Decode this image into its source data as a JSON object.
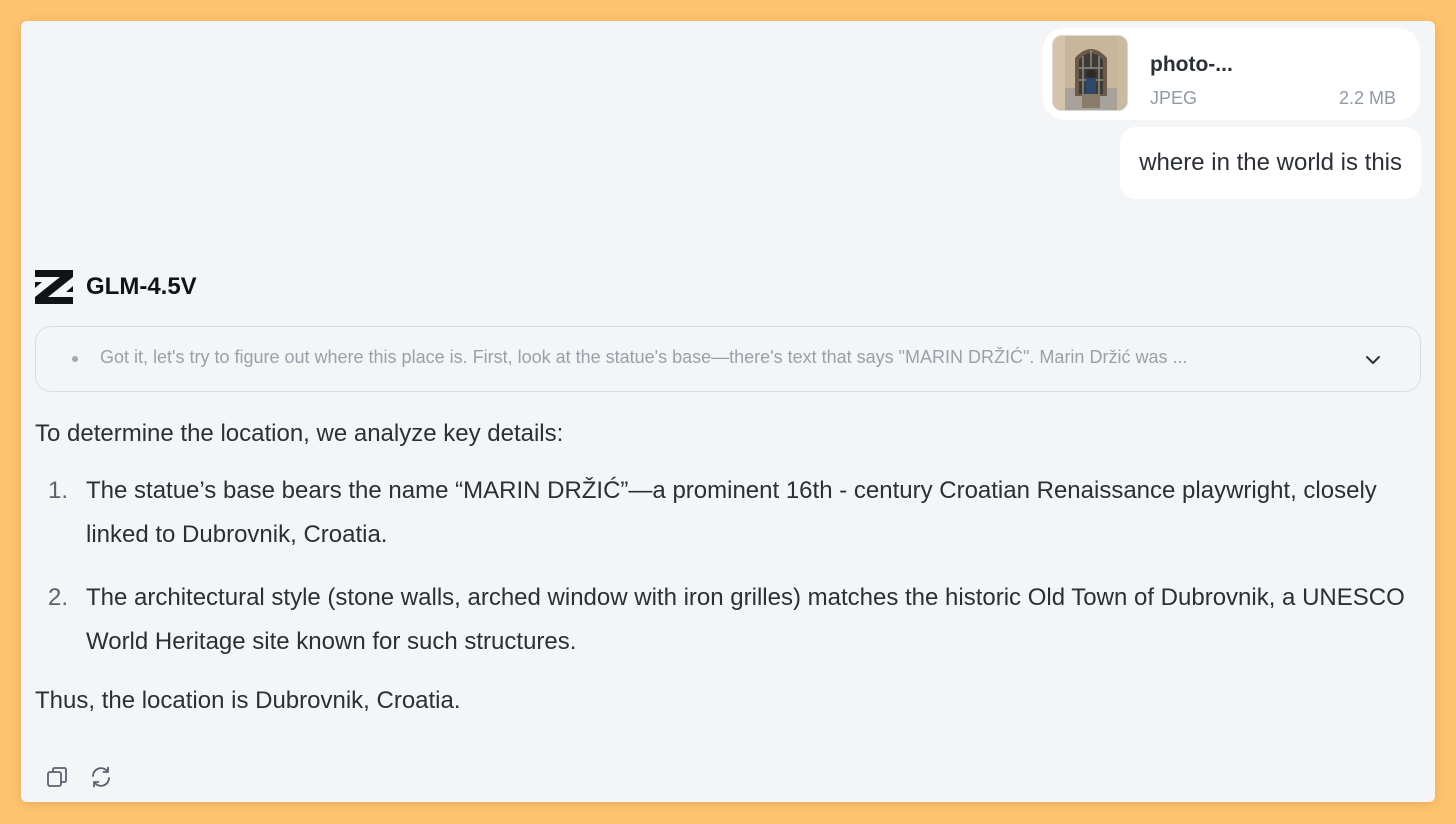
{
  "attachment": {
    "name": "photo-...",
    "type": "JPEG",
    "size": "2.2 MB",
    "thumbnail_icon": "photo-thumbnail"
  },
  "user_message": "where in the world is this",
  "model": {
    "name": "GLM-4.5V",
    "logo_icon": "z-logo-icon"
  },
  "thinking": {
    "preview": "Got it, let's try to figure out where this place is. First, look at the statue's base—there's text that says \"MARIN DRŽIĆ\". Marin Držić was ...",
    "expand_icon": "chevron-down-icon"
  },
  "answer": {
    "intro": "To determine the location, we analyze key details:",
    "items": [
      {
        "number": "1.",
        "text": "The statue’s base bears the name “MARIN DRŽIĆ”—a prominent 16th - century Croatian Renaissance playwright, closely linked to Dubrovnik, Croatia."
      },
      {
        "number": "2.",
        "text": "The architectural style (stone walls, arched window with iron grilles) matches the historic Old Town of Dubrovnik, a UNESCO World Heritage site known for such structures."
      }
    ],
    "outro": "Thus, the location is Dubrovnik, Croatia."
  },
  "actions": [
    {
      "icon": "copy-icon"
    },
    {
      "icon": "regenerate-icon"
    }
  ],
  "colors": {
    "page_background": "#fec36e",
    "window_background": "#f4f5f7",
    "bubble_background": "#ffffff",
    "muted_text": "#9aa0a9"
  }
}
